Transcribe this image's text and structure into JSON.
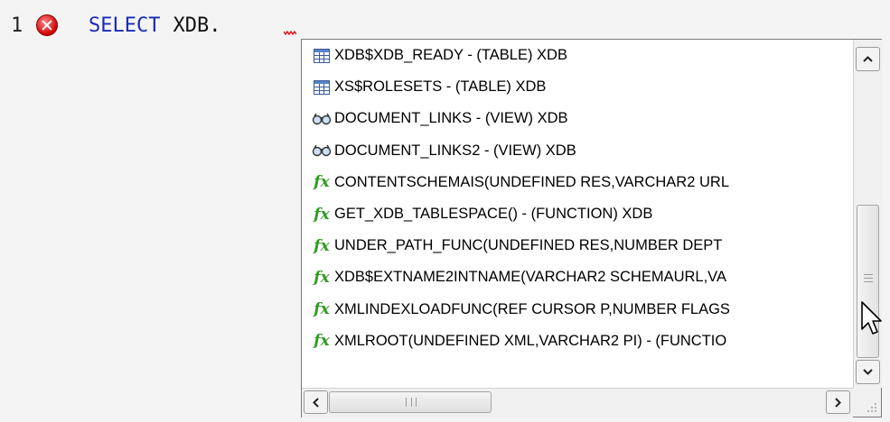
{
  "editor": {
    "line_number": "1",
    "keyword": "SELECT",
    "text": "XDB.",
    "error_color": "#d00000",
    "keyword_color": "#1a2bb8"
  },
  "completion": {
    "items": [
      {
        "icon": "table-icon",
        "label": "XDB$XDB_READY - (TABLE) XDB"
      },
      {
        "icon": "table-icon",
        "label": "XS$ROLESETS - (TABLE) XDB"
      },
      {
        "icon": "view-icon",
        "label": "DOCUMENT_LINKS - (VIEW) XDB"
      },
      {
        "icon": "view-icon",
        "label": "DOCUMENT_LINKS2 - (VIEW) XDB"
      },
      {
        "icon": "function-icon",
        "label": "CONTENTSCHEMAIS(UNDEFINED RES,VARCHAR2 URL"
      },
      {
        "icon": "function-icon",
        "label": "GET_XDB_TABLESPACE() - (FUNCTION) XDB"
      },
      {
        "icon": "function-icon",
        "label": "UNDER_PATH_FUNC(UNDEFINED RES,NUMBER DEPT"
      },
      {
        "icon": "function-icon",
        "label": "XDB$EXTNAME2INTNAME(VARCHAR2 SCHEMAURL,VA"
      },
      {
        "icon": "function-icon",
        "label": "XMLINDEXLOADFUNC(REF CURSOR P,NUMBER FLAGS"
      },
      {
        "icon": "function-icon",
        "label": "XMLROOT(UNDEFINED XML,VARCHAR2 PI) - (FUNCTIO"
      }
    ],
    "function_glyph": "fx",
    "function_color": "#2f9a22"
  }
}
